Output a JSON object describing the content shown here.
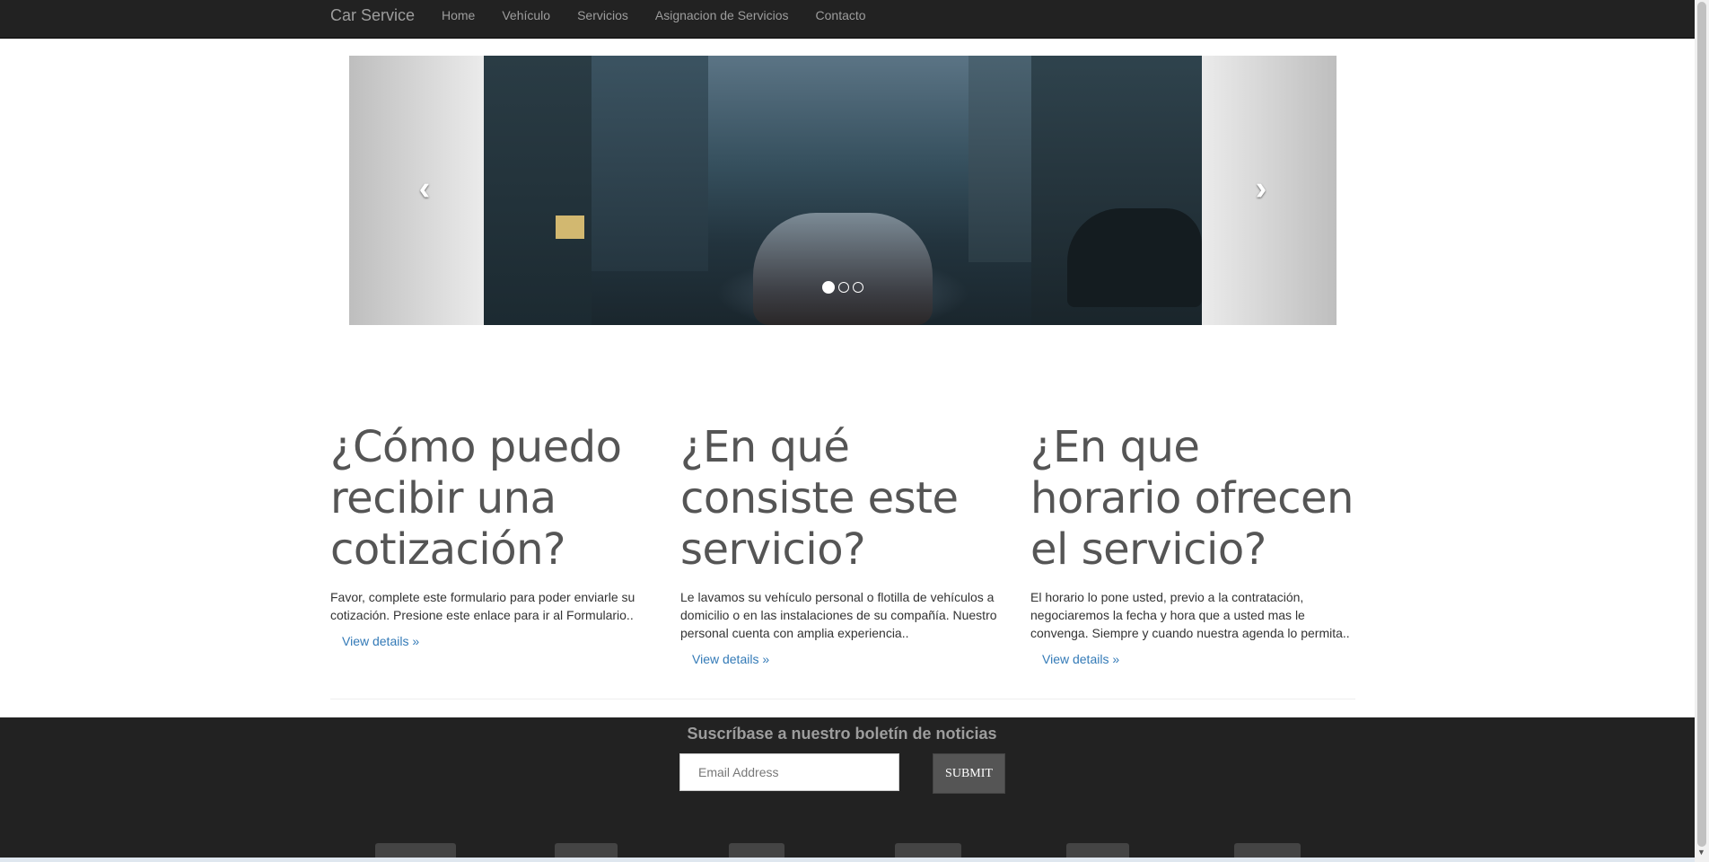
{
  "navbar": {
    "brand": "Car Service",
    "items": [
      {
        "label": "Home"
      },
      {
        "label": "Vehículo"
      },
      {
        "label": "Servicios"
      },
      {
        "label": "Asignacion de Servicios"
      },
      {
        "label": "Contacto"
      }
    ]
  },
  "carousel": {
    "prev_icon": "chevron-left-icon",
    "next_icon": "chevron-right-icon",
    "prev_glyph": "‹",
    "next_glyph": "›",
    "slide_count": 3,
    "active_slide": 1
  },
  "columns": [
    {
      "heading": "¿Cómo puedo recibir una cotización?",
      "body": "Favor, complete este formulario para poder enviarle su cotización. Presione este enlace para ir al Formulario..",
      "link": "View details »"
    },
    {
      "heading": "¿En qué consiste este servicio?",
      "body": "Le lavamos su vehículo personal o flotilla de vehículos a domicilio o en las instalaciones de su compañía. Nuestro personal cuenta con amplia experiencia..",
      "link": "View details »"
    },
    {
      "heading": "¿En que horario ofrecen el servicio?",
      "body": "El horario lo pone usted, previo a la contratación, negociaremos la fecha y hora que a usted mas le convenga. Siempre y cuando nuestra agenda lo permita..",
      "link": "View details »"
    }
  ],
  "footer": {
    "newsletter_title": "Suscríbase a nuestro boletín de noticias",
    "email_placeholder": "Email Address",
    "submit_label": "SUBMIT"
  },
  "colors": {
    "navbar_bg": "#222222",
    "nav_text": "#9d9d9d",
    "link": "#337ab7",
    "heading": "#555555"
  }
}
